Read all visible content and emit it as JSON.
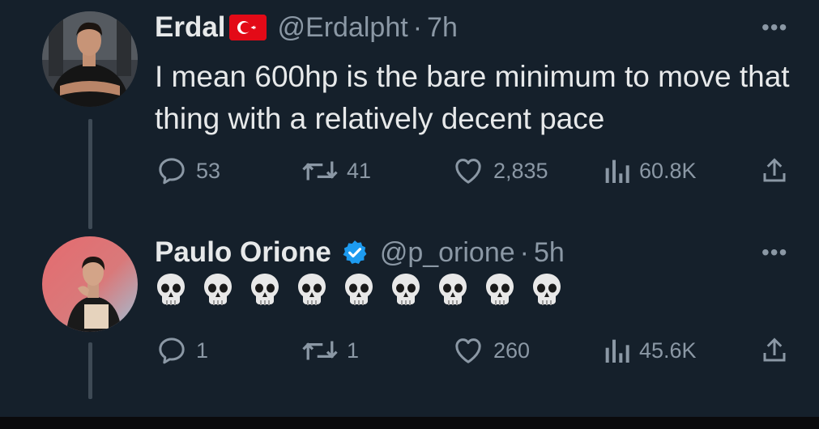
{
  "tweets": [
    {
      "display_name": "Erdal",
      "handle": "@Erdalpht",
      "time": "7h",
      "text": "I mean 600hp is the bare minimum to move that thing with a relatively decent pace",
      "replies": "53",
      "reposts": "41",
      "likes": "2,835",
      "views": "60.8K",
      "badge": "turkey-flag-icon"
    },
    {
      "display_name": "Paulo Orione",
      "handle": "@p_orione",
      "time": "5h",
      "emoji": [
        "💀",
        "💀",
        "💀",
        "💀",
        "💀",
        "💀",
        "💀",
        "💀",
        "💀"
      ],
      "replies": "1",
      "reposts": "1",
      "likes": "260",
      "views": "45.6K",
      "badge": "verified-badge-icon"
    }
  ],
  "separator": "·",
  "more_label": "•••",
  "colors": {
    "background": "#15202b",
    "text": "#e7e9ea",
    "muted": "#8b98a5",
    "verified": "#1d9bf0",
    "flag": "#e30a17"
  }
}
